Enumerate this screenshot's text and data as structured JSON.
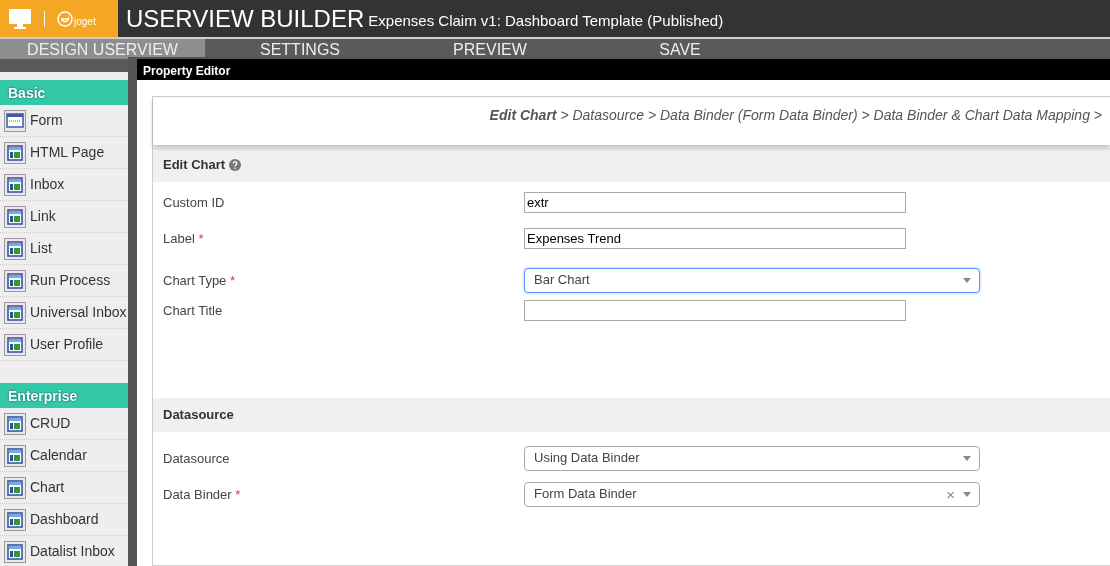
{
  "header": {
    "logo_text": "joget",
    "title": "USERVIEW BUILDER",
    "subtitle": "Expenses Claim v1: Dashboard Template (Published)"
  },
  "tabs": [
    {
      "label": "DESIGN USERVIEW",
      "selected": true
    },
    {
      "label": "SETTINGS",
      "selected": false
    },
    {
      "label": "PREVIEW",
      "selected": false
    },
    {
      "label": "SAVE",
      "selected": false
    }
  ],
  "palette": [
    {
      "title": "Basic",
      "items": [
        {
          "label": "Form",
          "kind": "form"
        },
        {
          "label": "HTML Page",
          "kind": "page"
        },
        {
          "label": "Inbox",
          "kind": "page"
        },
        {
          "label": "Link",
          "kind": "page"
        },
        {
          "label": "List",
          "kind": "page"
        },
        {
          "label": "Run Process",
          "kind": "page"
        },
        {
          "label": "Universal Inbox",
          "kind": "page"
        },
        {
          "label": "User Profile",
          "kind": "page"
        }
      ]
    },
    {
      "title": "Enterprise",
      "items": [
        {
          "label": "CRUD",
          "kind": "page"
        },
        {
          "label": "Calendar",
          "kind": "page"
        },
        {
          "label": "Chart",
          "kind": "page"
        },
        {
          "label": "Dashboard",
          "kind": "page"
        },
        {
          "label": "Datalist Inbox",
          "kind": "page"
        }
      ]
    }
  ],
  "dialog": {
    "title": "Property Editor",
    "breadcrumb": "**Edit Chart** > Datasource > Data Binder (Form Data Binder) > Data Binder & Chart Data Mapping >",
    "sections": [
      {
        "title": "Edit Chart",
        "help": true,
        "fields": [
          {
            "label": "Custom ID",
            "kind": "text",
            "value": "extr",
            "focused": false
          },
          {
            "label": "Label",
            "required_mark": "*",
            "kind": "text",
            "value": "Expenses Trend",
            "focused": false
          },
          {
            "label": "Chart Type",
            "required_mark": "*",
            "kind": "select",
            "value": "Bar Chart",
            "focused": true
          },
          {
            "label": "Chart Title",
            "kind": "text",
            "focused": false
          }
        ]
      },
      {
        "title": "Datasource",
        "help": false,
        "fields": [
          {
            "label": "Datasource",
            "kind": "select",
            "value": "Using Data Binder",
            "focused": false
          },
          {
            "label": "Data Binder",
            "required_mark": "*",
            "kind": "select",
            "value": "Form Data Binder",
            "clear": "×",
            "focused": false
          }
        ]
      }
    ]
  }
}
